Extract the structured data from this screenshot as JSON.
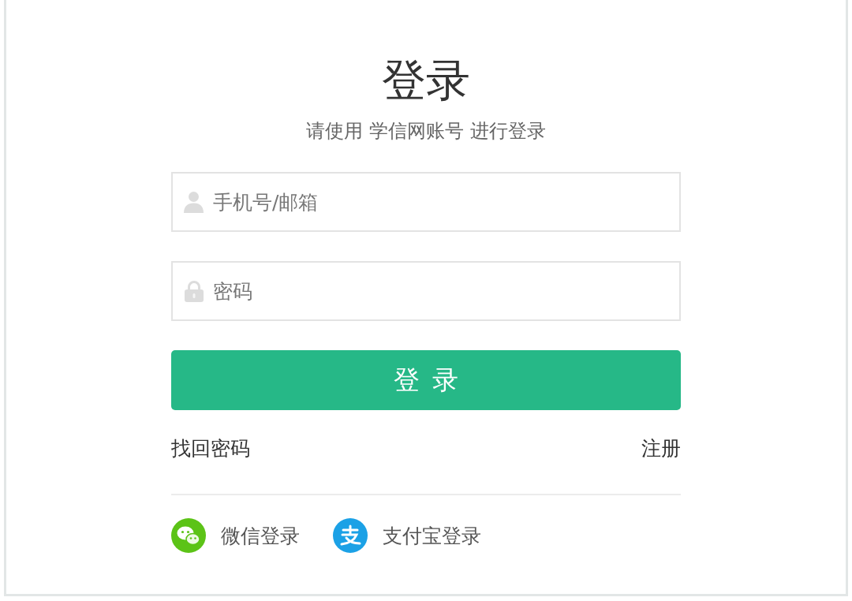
{
  "title": "登录",
  "subtitle": "请使用 学信网账号 进行登录",
  "fields": [
    {
      "kind": "account",
      "placeholder": "手机号/邮箱"
    },
    {
      "kind": "password",
      "placeholder": "密码"
    }
  ],
  "submit_button": "登 录",
  "forgot_password_link": "找回密码",
  "register_link": "注册",
  "social_logins": [
    {
      "kind": "wechat",
      "label": "微信登录"
    },
    {
      "kind": "alipay",
      "label": "支付宝登录"
    }
  ]
}
